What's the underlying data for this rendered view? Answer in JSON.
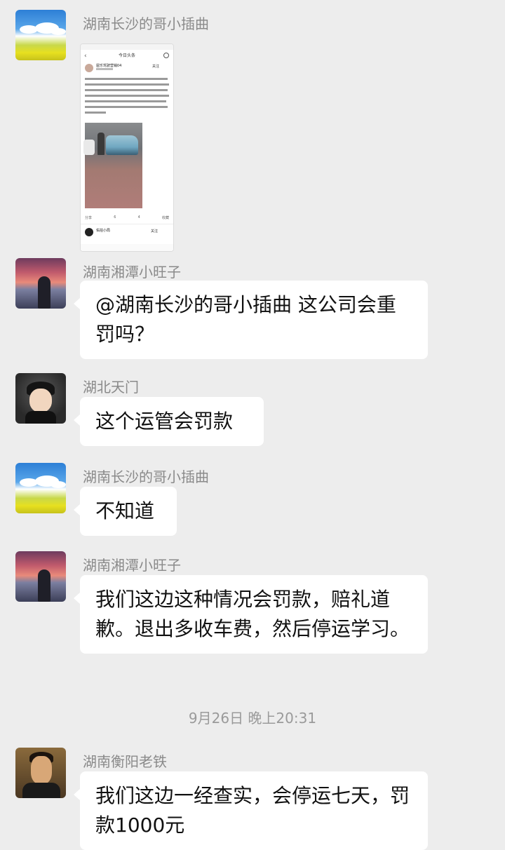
{
  "messages": [
    {
      "sender": "湖南长沙的哥小插曲",
      "type": "image"
    },
    {
      "sender": "湖南湘潭小旺子",
      "text": "@湖南长沙的哥小插曲  这公司会重罚吗？"
    },
    {
      "sender": "湖北天门",
      "text": "这个运管会罚款"
    },
    {
      "sender": "湖南长沙的哥小插曲",
      "text": "不知道"
    },
    {
      "sender": "湖南湘潭小旺子",
      "text": "我们这边这种情况会罚款，赔礼道歉。退出多收车费，然后停运学习。"
    },
    {
      "sender": "湖南衡阳老铁",
      "text": "我们这边一经查实，会停运七天，罚款1000元"
    }
  ],
  "timestamp": "9月26日 晚上20:31",
  "shared_image": {
    "title": "今日头条",
    "author": "屋乐驾驶营销04",
    "follow": "关注",
    "actions": [
      "分享",
      "6",
      "4",
      "收藏"
    ],
    "commenter": "佑拍小局",
    "comment_follow": "关注"
  },
  "colors": {
    "background": "#ededed",
    "bubble": "#ffffff",
    "sender": "#8a8a8a"
  }
}
